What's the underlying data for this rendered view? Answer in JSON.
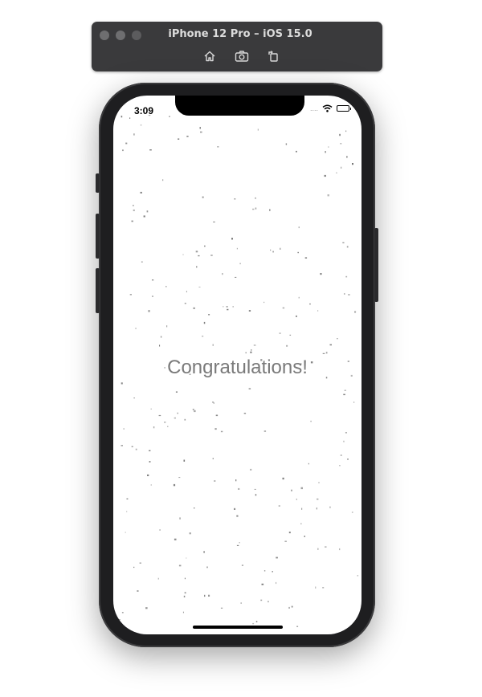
{
  "simulator": {
    "title": "iPhone 12 Pro – iOS 15.0",
    "toolbar": {
      "home_icon": "home-icon",
      "screenshot_icon": "camera-icon",
      "rotate_icon": "rotate-icon"
    }
  },
  "status_bar": {
    "time": "3:09",
    "signal": "....",
    "wifi_icon": "wifi-icon",
    "battery_icon": "battery-icon"
  },
  "screen": {
    "headline": "Congratulations!",
    "confetti_color": "#6f6f6f"
  }
}
